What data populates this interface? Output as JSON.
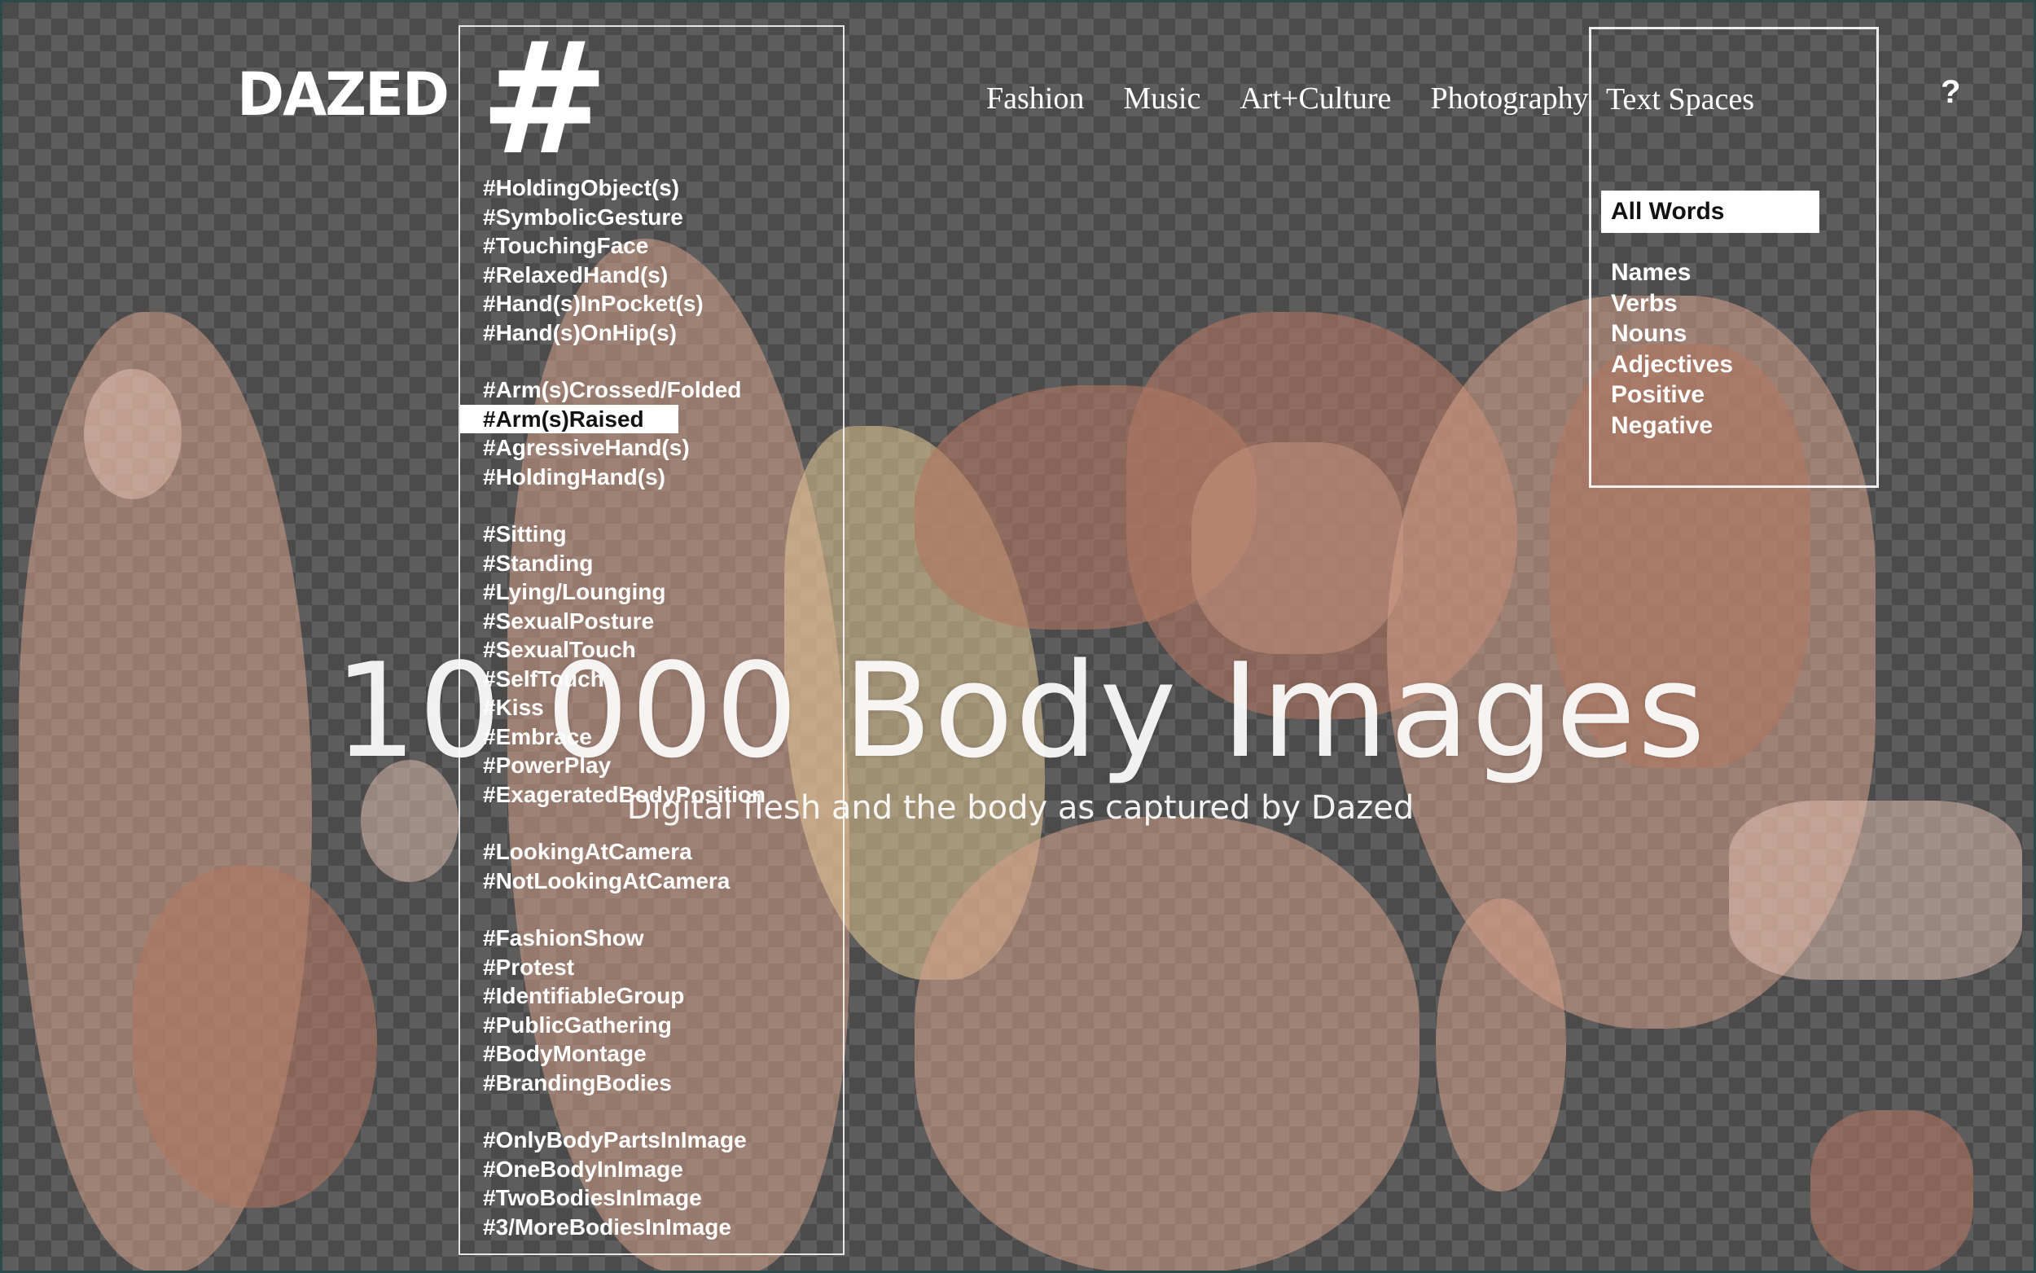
{
  "brand": {
    "logo_text": "DAZED",
    "hash_symbol": "#"
  },
  "nav": {
    "items": [
      {
        "label": "Fashion"
      },
      {
        "label": "Music"
      },
      {
        "label": "Art+Culture"
      },
      {
        "label": "Photography"
      }
    ],
    "text_spaces_label": "Text Spaces",
    "help_label": "?"
  },
  "word_filters": {
    "active": "All Words",
    "items": [
      "Names",
      "Verbs",
      "Nouns",
      "Adjectives",
      "Positive",
      "Negative"
    ]
  },
  "tags": {
    "active": "#Arm(s)Raised",
    "groups": [
      [
        "#HoldingObject(s)",
        "#SymbolicGesture",
        "#TouchingFace",
        "#RelaxedHand(s)",
        "#Hand(s)InPocket(s)",
        "#Hand(s)OnHip(s)"
      ],
      [
        "#Arm(s)Crossed/Folded",
        "#Arm(s)Raised",
        "#AgressiveHand(s)",
        "#HoldingHand(s)"
      ],
      [
        "#Sitting",
        "#Standing",
        "#Lying/Lounging",
        "#SexualPosture",
        "#SexualTouch",
        "#SelfTouch",
        "#Kiss",
        "#Embrace",
        "#PowerPlay",
        "#ExageratedBodyPosition"
      ],
      [
        "#LookingAtCamera",
        "#NotLookingAtCamera"
      ],
      [
        "#FashionShow",
        "#Protest",
        "#IdentifiableGroup",
        "#PublicGathering",
        "#BodyMontage",
        "#BrandingBodies"
      ],
      [
        "#OnlyBodyPartsInImage",
        "#OneBodyInImage",
        "#TwoBodiesInImage",
        "#3/MoreBodiesInImage"
      ]
    ]
  },
  "hero": {
    "title": "10 000 Body Images",
    "subtitle": "Digital flesh and the body as captured by Dazed"
  }
}
